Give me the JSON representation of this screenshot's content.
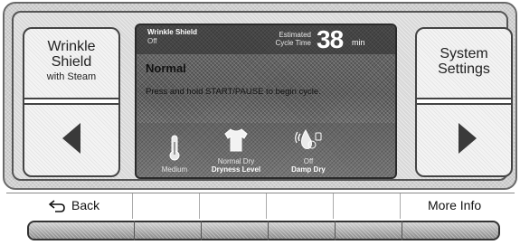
{
  "left_panel": {
    "line1": "Wrinkle",
    "line2": "Shield",
    "line3": "with Steam"
  },
  "right_panel": {
    "line1": "System",
    "line2": "Settings"
  },
  "display": {
    "wrinkle_shield_title": "Wrinkle Shield",
    "wrinkle_shield_value": "Off",
    "estimated_label_1": "Estimated",
    "estimated_label_2": "Cycle Time",
    "time_value": "38",
    "time_unit": "min",
    "cycle_name": "Normal",
    "instruction": "Press and hold START/PAUSE to begin cycle.",
    "options": [
      {
        "value": "Medium",
        "label": "",
        "icon": "thermometer-icon"
      },
      {
        "value": "Normal Dry",
        "label": "Dryness Level",
        "icon": "shirt-icon"
      },
      {
        "value": "Off",
        "label": "Damp Dry",
        "icon": "damp-dry-icon"
      }
    ]
  },
  "buttons": {
    "back": "Back",
    "more_info": "More Info"
  },
  "icons": {
    "back": "back-arrow-icon",
    "left": "left-arrow-icon",
    "right": "right-arrow-icon"
  }
}
